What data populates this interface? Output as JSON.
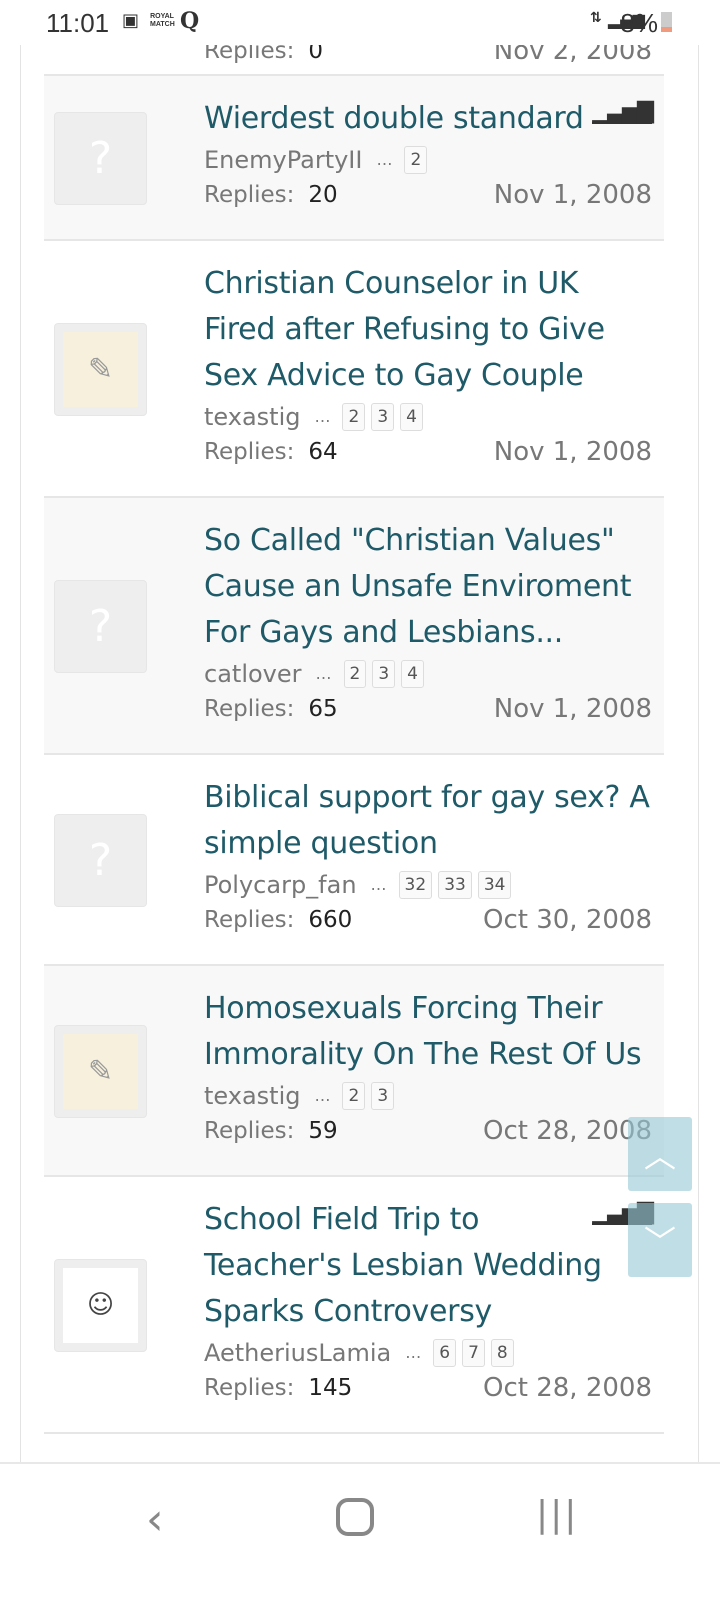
{
  "status": {
    "time": "11:01",
    "battery": "8%",
    "icons": [
      "image-icon",
      "royal-match-icon",
      "q-icon",
      "data-icon",
      "signal-icon",
      "battery-icon"
    ],
    "app_label": "ROYAL MATCH"
  },
  "partial": {
    "replies_label": "Replies:",
    "replies": "0",
    "date": "Nov 2, 2008"
  },
  "threads": [
    {
      "title": "Wierdest double standard",
      "author": "EnemyPartyII",
      "pages": [
        "2"
      ],
      "replies_label": "Replies:",
      "replies": "20",
      "date": "Nov 1, 2008",
      "avatar": "placeholder",
      "stats": true
    },
    {
      "title": "Christian Counselor in UK Fired after Refusing to Give Sex Advice to Gay Couple",
      "author": "texastig",
      "pages": [
        "2",
        "3",
        "4"
      ],
      "replies_label": "Replies:",
      "replies": "64",
      "date": "Nov 1, 2008",
      "avatar": "sketch",
      "stats": false
    },
    {
      "title": "So Called \"Christian Values\" Cause an Unsafe Enviroment For Gays and Lesbians...",
      "author": "catlover",
      "pages": [
        "2",
        "3",
        "4"
      ],
      "replies_label": "Replies:",
      "replies": "65",
      "date": "Nov 1, 2008",
      "avatar": "placeholder",
      "stats": false
    },
    {
      "title": "Biblical support for gay sex? A simple question",
      "author": "Polycarp_fan",
      "pages": [
        "32",
        "33",
        "34"
      ],
      "replies_label": "Replies:",
      "replies": "660",
      "date": "Oct 30, 2008",
      "avatar": "placeholder",
      "stats": false
    },
    {
      "title": "Homosexuals Forcing Their Immorality On The Rest Of Us",
      "author": "texastig",
      "pages": [
        "2",
        "3"
      ],
      "replies_label": "Replies:",
      "replies": "59",
      "date": "Oct 28, 2008",
      "avatar": "sketch",
      "stats": false
    },
    {
      "title": "School Field Trip to Teacher's Lesbian Wedding Sparks Controversy",
      "author": "AetheriusLamia",
      "pages": [
        "6",
        "7",
        "8"
      ],
      "replies_label": "Replies:",
      "replies": "145",
      "date": "Oct 28, 2008",
      "avatar": "comic",
      "stats": true
    }
  ],
  "ellipsis": "…",
  "placeholder_glyph": "?",
  "colors": {
    "title": "#1f5a68",
    "scroll_button": "#96c8d4",
    "alt_row": "#f8f8f8"
  }
}
